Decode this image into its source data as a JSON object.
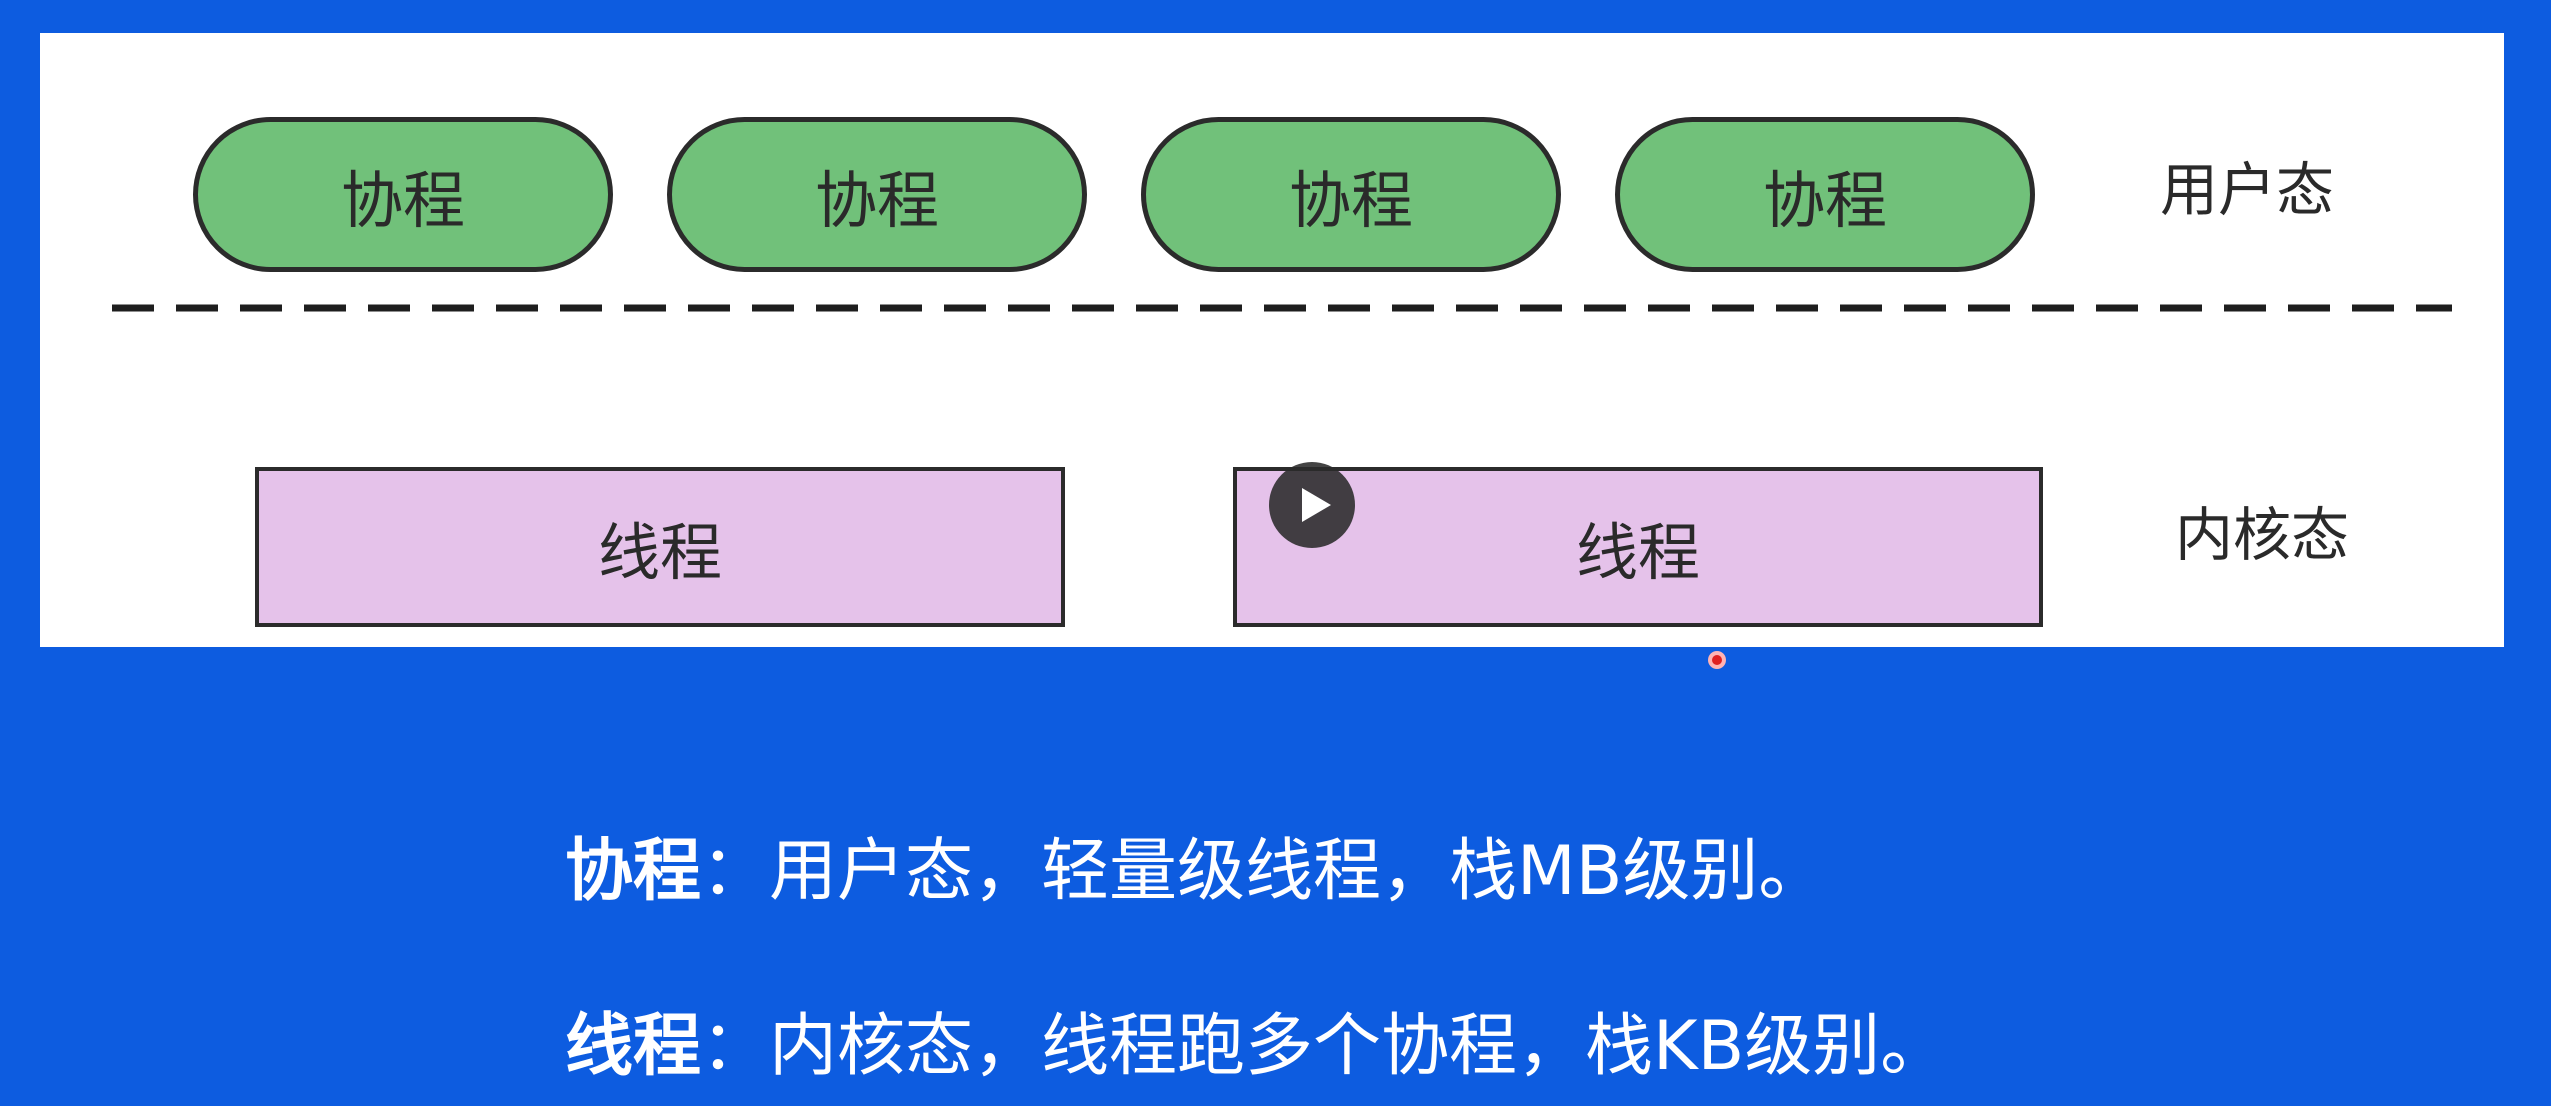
{
  "diagram": {
    "coroutines": [
      "协程",
      "协程",
      "协程",
      "协程"
    ],
    "threads": [
      "线程",
      "线程"
    ],
    "user_mode_label": "用户态",
    "kernel_mode_label": "内核态"
  },
  "captions": [
    {
      "term": "协程",
      "sep": "：",
      "text": "用户态，轻量级线程，栈MB级别。"
    },
    {
      "term": "线程",
      "sep": "：",
      "text": "内核态，线程跑多个协程，栈KB级别。"
    }
  ],
  "colors": {
    "background": "#0d5ce0",
    "coroutine_fill": "#71c17a",
    "thread_fill": "#e5c2ea",
    "outline": "#2b2b2b"
  },
  "icons": {
    "overlay": "play-icon",
    "cursor": "red-dot-icon"
  }
}
